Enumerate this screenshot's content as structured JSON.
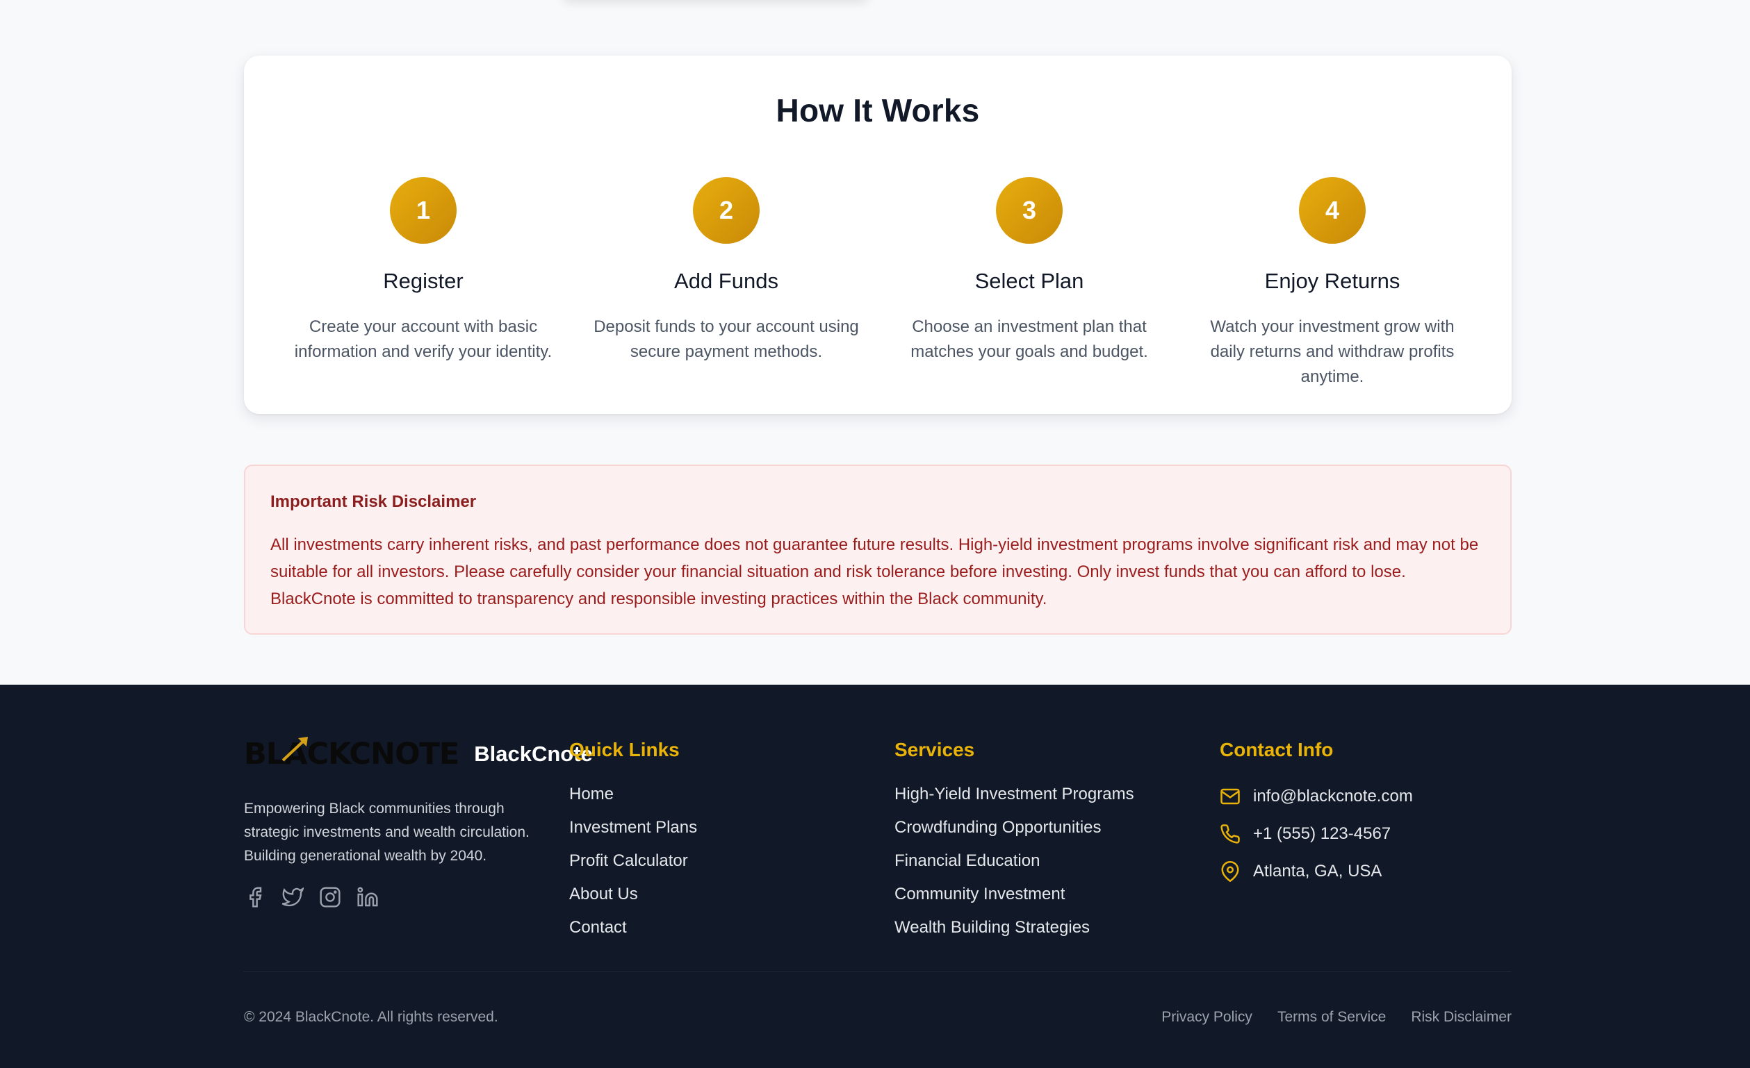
{
  "how_it_works": {
    "title": "How It Works",
    "steps": [
      {
        "number": "1",
        "title": "Register",
        "description": "Create your account with basic information and verify your identity."
      },
      {
        "number": "2",
        "title": "Add Funds",
        "description": "Deposit funds to your account using secure payment methods."
      },
      {
        "number": "3",
        "title": "Select Plan",
        "description": "Choose an investment plan that matches your goals and budget."
      },
      {
        "number": "4",
        "title": "Enjoy Returns",
        "description": "Watch your investment grow with daily returns and withdraw profits anytime."
      }
    ]
  },
  "disclaimer": {
    "title": "Important Risk Disclaimer",
    "text": "All investments carry inherent risks, and past performance does not guarantee future results. High-yield investment programs involve significant risk and may not be suitable for all investors. Please carefully consider your financial situation and risk tolerance before investing. Only invest funds that you can afford to lose. BlackCnote is committed to transparency and responsible investing practices within the Black community."
  },
  "footer": {
    "logo_text": "BLACKCNOTE",
    "brand_name": "BlackCnote",
    "description": "Empowering Black communities through strategic investments and wealth circulation. Building generational wealth by 2040.",
    "socials": [
      "facebook-icon",
      "twitter-icon",
      "instagram-icon",
      "linkedin-icon"
    ],
    "quick_links": {
      "title": "Quick Links",
      "items": [
        "Home",
        "Investment Plans",
        "Profit Calculator",
        "About Us",
        "Contact"
      ]
    },
    "services": {
      "title": "Services",
      "items": [
        "High-Yield Investment Programs",
        "Crowdfunding Opportunities",
        "Financial Education",
        "Community Investment",
        "Wealth Building Strategies"
      ]
    },
    "contact": {
      "title": "Contact Info",
      "email": "info@blackcnote.com",
      "phone": "+1 (555) 123-4567",
      "location": "Atlanta, GA, USA"
    },
    "copyright": "© 2024 BlackCnote. All rights reserved.",
    "legal_links": [
      "Privacy Policy",
      "Terms of Service",
      "Risk Disclaimer"
    ]
  },
  "colors": {
    "accent": "#eab308",
    "step_circle": "#d99a09",
    "footer_bg": "#111827",
    "disclaimer_bg": "#fdf0f0",
    "disclaimer_text": "#9b1c1c"
  }
}
